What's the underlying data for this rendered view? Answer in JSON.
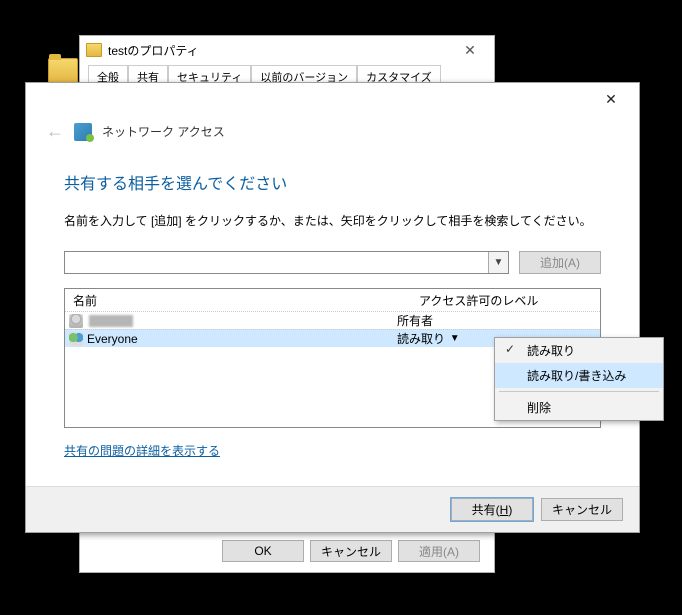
{
  "prop_window": {
    "title": "testのプロパティ",
    "tabs": [
      "全般",
      "共有",
      "セキュリティ",
      "以前のバージョン",
      "カスタマイズ"
    ],
    "active_tab_index": 1,
    "buttons": {
      "ok": "OK",
      "cancel": "キャンセル",
      "apply": "適用(A)"
    }
  },
  "net_window": {
    "header_title": "ネットワーク アクセス",
    "heading": "共有する相手を選んでください",
    "instruction": "名前を入力して [追加] をクリックするか、または、矢印をクリックして相手を検索してください。",
    "add_button": "追加(A)",
    "table": {
      "col_name": "名前",
      "col_perm": "アクセス許可のレベル",
      "rows": [
        {
          "name_display": "",
          "blurred": true,
          "perm": "所有者",
          "selected": false,
          "icon": "user"
        },
        {
          "name_display": "Everyone",
          "blurred": false,
          "perm": "読み取り",
          "selected": true,
          "icon": "group"
        }
      ]
    },
    "context_menu": {
      "items": [
        {
          "label": "読み取り",
          "checked": true,
          "selected": false
        },
        {
          "label": "読み取り/書き込み",
          "checked": false,
          "selected": true
        }
      ],
      "delete": "削除"
    },
    "details_link": "共有の問題の詳細を表示する",
    "footer": {
      "share": "共有(H)",
      "cancel": "キャンセル"
    }
  }
}
